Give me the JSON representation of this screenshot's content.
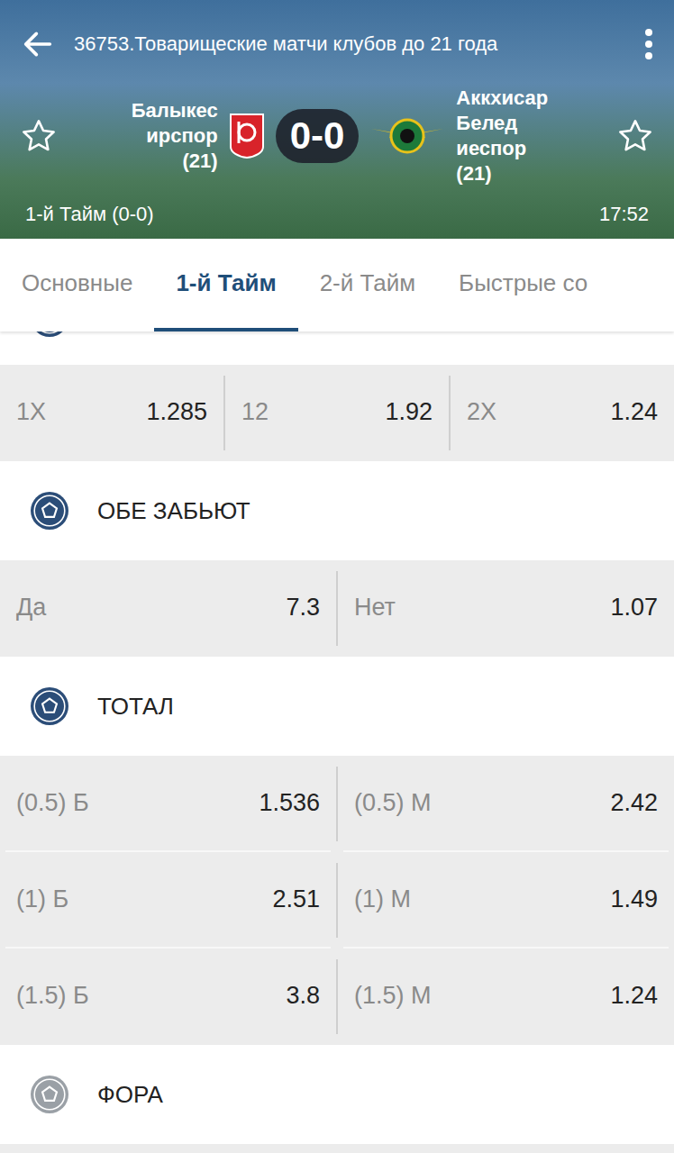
{
  "header": {
    "title": "36753.Товарищеские матчи клубов до 21 года",
    "home": {
      "name_lines": [
        "Балыкес",
        "ирспор",
        "(21)"
      ],
      "favorite": false
    },
    "score": "0-0",
    "away": {
      "name_lines": [
        "Аккхисар",
        "Белед",
        "иеспор",
        "(21)"
      ],
      "favorite": false
    },
    "period": "1-й Тайм (0-0)",
    "clock": "17:52"
  },
  "tabs": [
    {
      "label": "Основные",
      "selected": false
    },
    {
      "label": "1-й Тайм",
      "selected": true
    },
    {
      "label": "2-й Тайм",
      "selected": false
    },
    {
      "label": "Быстрые со",
      "selected": false
    }
  ],
  "markets": [
    {
      "title": "",
      "expanded": true,
      "rows": [
        [
          {
            "label": "1X",
            "odds": "1.285"
          },
          {
            "label": "12",
            "odds": "1.92"
          },
          {
            "label": "2X",
            "odds": "1.24"
          }
        ]
      ]
    },
    {
      "title": "ОБЕ ЗАБЬЮТ",
      "expanded": true,
      "rows": [
        [
          {
            "label": "Да",
            "odds": "7.3"
          },
          {
            "label": "Нет",
            "odds": "1.07"
          }
        ]
      ]
    },
    {
      "title": "ТОТАЛ",
      "expanded": true,
      "rows": [
        [
          {
            "label": "(0.5) Б",
            "odds": "1.536"
          },
          {
            "label": "(0.5) М",
            "odds": "2.42"
          }
        ],
        [
          {
            "label": "(1) Б",
            "odds": "2.51"
          },
          {
            "label": "(1) М",
            "odds": "1.49"
          }
        ],
        [
          {
            "label": "(1.5) Б",
            "odds": "3.8"
          },
          {
            "label": "(1.5) М",
            "odds": "1.24"
          }
        ]
      ]
    },
    {
      "title": "ФОРА",
      "expanded": false,
      "rows": []
    }
  ]
}
